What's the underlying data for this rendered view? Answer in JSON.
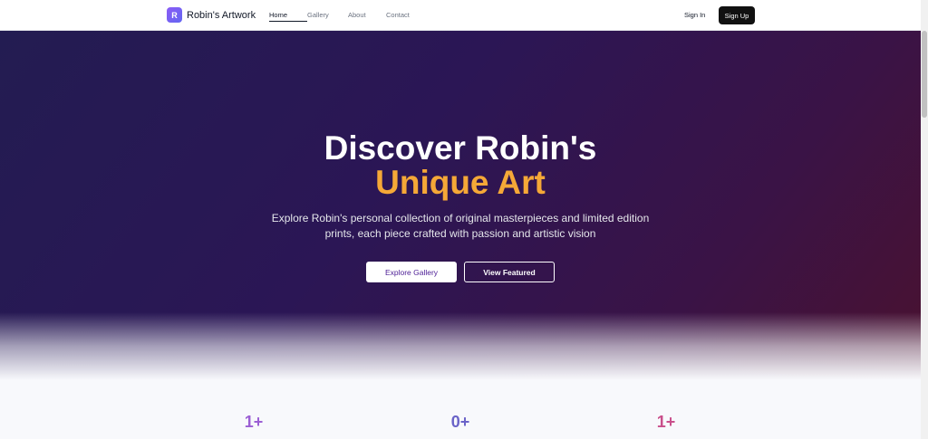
{
  "nav": {
    "brand_letter": "R",
    "brand_name": "Robin's Artwork",
    "links": [
      "Home",
      "Gallery",
      "About",
      "Contact"
    ],
    "sign_in": "Sign In",
    "sign_up": "Sign Up"
  },
  "hero": {
    "title_line1": "Discover Robin's",
    "title_line2": "Unique Art",
    "subtitle": "Explore Robin's personal collection of original masterpieces and limited edition prints, each piece crafted with passion and artistic vision",
    "primary_button": "Explore Gallery",
    "secondary_button": "View Featured",
    "accent_color": "#f5a837"
  },
  "stats": [
    "1+",
    "0+",
    "1+"
  ]
}
